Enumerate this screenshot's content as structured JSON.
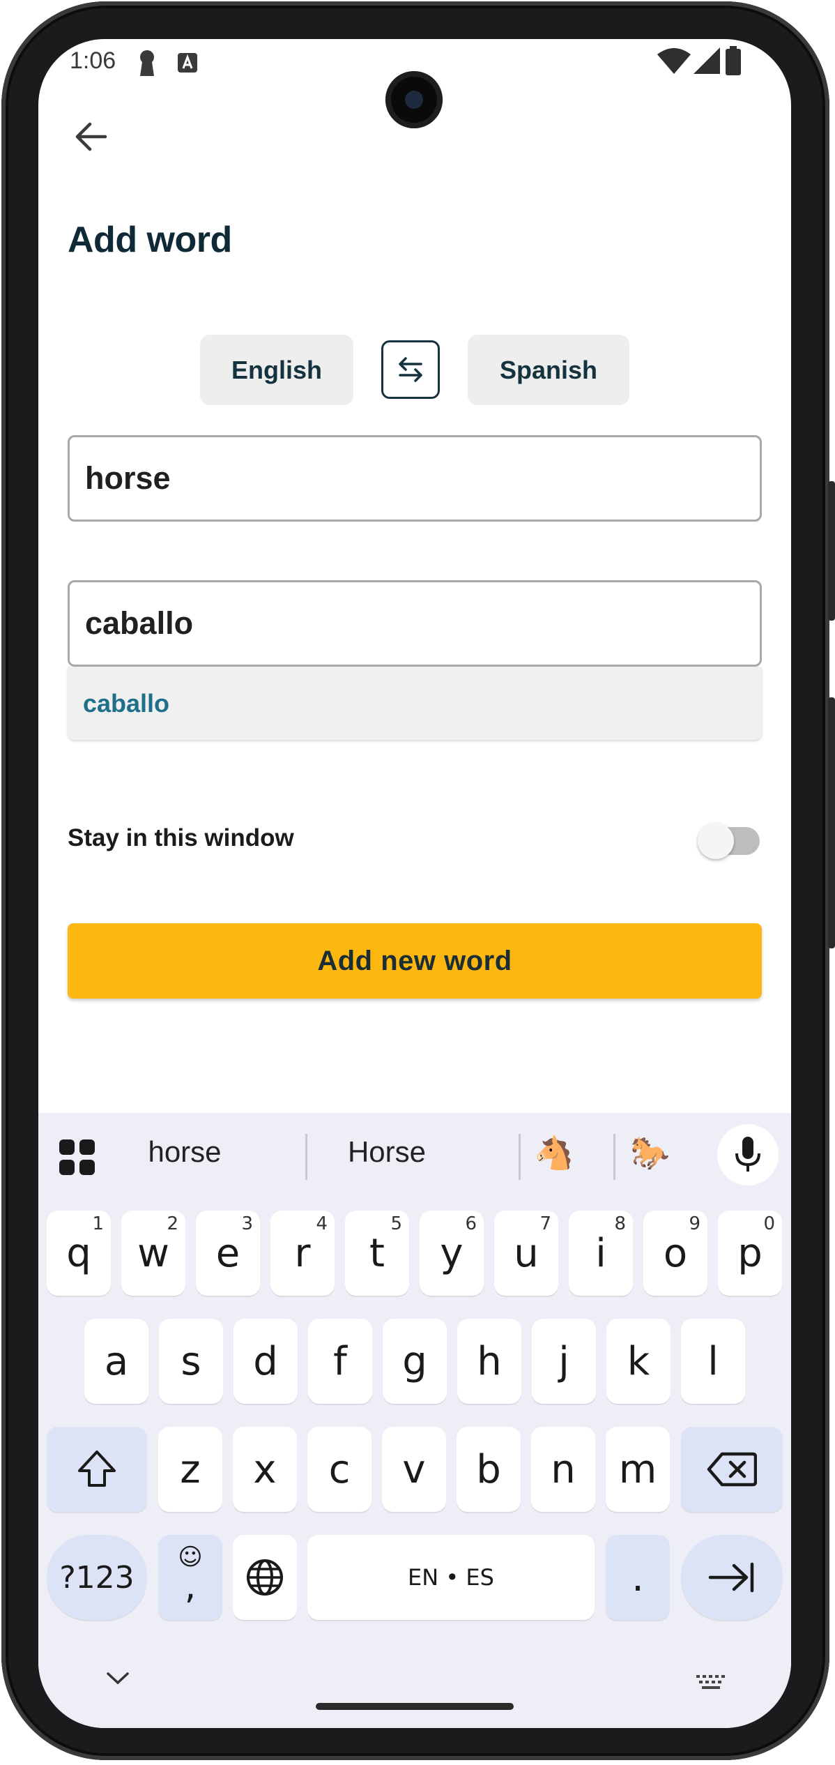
{
  "status_bar": {
    "time": "1:06"
  },
  "header": {
    "title": "Add word"
  },
  "languages": {
    "source": "English",
    "target": "Spanish"
  },
  "fields": {
    "source_value": "horse",
    "target_value": "caballo"
  },
  "suggestion": {
    "text": "caballo"
  },
  "options": {
    "stay_label": "Stay in this window",
    "stay_enabled": false
  },
  "actions": {
    "add_label": "Add new word"
  },
  "keyboard": {
    "suggestions": [
      "horse",
      "Horse"
    ],
    "emoji": [
      "🐴",
      "🐎"
    ],
    "row1": [
      {
        "k": "q",
        "h": "1"
      },
      {
        "k": "w",
        "h": "2"
      },
      {
        "k": "e",
        "h": "3"
      },
      {
        "k": "r",
        "h": "4"
      },
      {
        "k": "t",
        "h": "5"
      },
      {
        "k": "y",
        "h": "6"
      },
      {
        "k": "u",
        "h": "7"
      },
      {
        "k": "i",
        "h": "8"
      },
      {
        "k": "o",
        "h": "9"
      },
      {
        "k": "p",
        "h": "0"
      }
    ],
    "row2": [
      "a",
      "s",
      "d",
      "f",
      "g",
      "h",
      "j",
      "k",
      "l"
    ],
    "row3": [
      "z",
      "x",
      "c",
      "v",
      "b",
      "n",
      "m"
    ],
    "symbols_label": "?123",
    "comma_label": ",",
    "period_label": ".",
    "space_label": "EN • ES"
  },
  "colors": {
    "accent": "#fcb711",
    "title": "#0f2a36",
    "suggestion": "#1e6f8a",
    "keyboard_bg": "#eeeef6"
  }
}
